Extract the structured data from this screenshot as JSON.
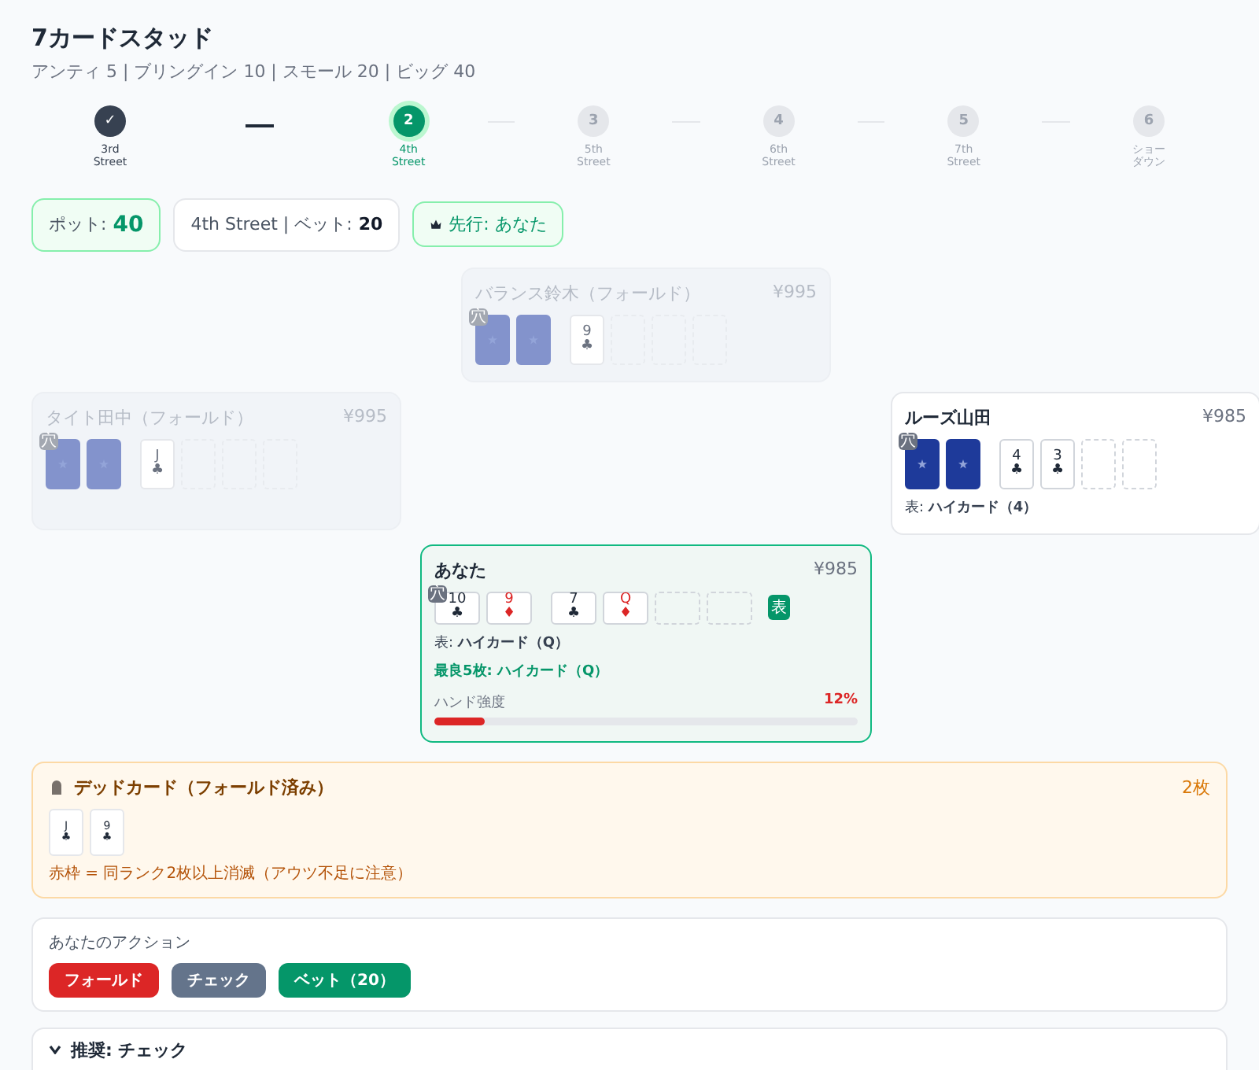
{
  "header": {
    "title": "7カードスタッド",
    "subtitle": "アンティ 5 | ブリングイン 10 | スモール 20 | ビッグ 40"
  },
  "streets": [
    {
      "mark": "✓",
      "lines": [
        "3rd",
        "Street"
      ],
      "completed": true,
      "selected": false
    },
    {
      "mark": "2",
      "lines": [
        "4th",
        "Street"
      ],
      "completed": false,
      "selected": true
    },
    {
      "mark": "3",
      "lines": [
        "5th",
        "Street"
      ],
      "completed": false,
      "selected": false
    },
    {
      "mark": "4",
      "lines": [
        "6th",
        "Street"
      ],
      "completed": false,
      "selected": false
    },
    {
      "mark": "5",
      "lines": [
        "7th",
        "Street"
      ],
      "completed": false,
      "selected": false
    },
    {
      "mark": "6",
      "lines": [
        "ショー",
        "ダウン"
      ],
      "completed": false,
      "selected": false
    }
  ],
  "chips": [
    {
      "kind": "pot",
      "label": "ポット: ",
      "value": "40"
    },
    {
      "kind": "bet",
      "label": "4th Street | ベット: ",
      "value": "20"
    },
    {
      "kind": "first",
      "label": "先行: あなた"
    }
  ],
  "seats": [
    {
      "name": "バランス鈴木（フォールド）",
      "stack": "¥995",
      "folded": true,
      "hero": false,
      "hole_badge": "穴",
      "cards": [
        {
          "kind": "down"
        },
        {
          "kind": "down"
        },
        {
          "kind": "up",
          "rank": "9",
          "suit": "♣",
          "color": "#6b7280"
        },
        {
          "kind": "empty"
        },
        {
          "kind": "empty"
        },
        {
          "kind": "empty"
        }
      ]
    },
    {
      "name": "タイト田中（フォールド）",
      "stack": "¥995",
      "folded": true,
      "hero": false,
      "hole_badge": "穴",
      "cards": [
        {
          "kind": "down"
        },
        {
          "kind": "down"
        },
        {
          "kind": "up",
          "rank": "J",
          "suit": "♣",
          "color": "#6b7280"
        },
        {
          "kind": "empty"
        },
        {
          "kind": "empty"
        },
        {
          "kind": "empty"
        }
      ]
    },
    {
      "name": "ルーズ山田",
      "stack": "¥985",
      "folded": false,
      "hero": false,
      "hole_badge": "穴",
      "cards": [
        {
          "kind": "down"
        },
        {
          "kind": "down"
        },
        {
          "kind": "up",
          "rank": "4",
          "suit": "♣",
          "color": "#1f2937"
        },
        {
          "kind": "up",
          "rank": "3",
          "suit": "♣",
          "color": "#1f2937"
        },
        {
          "kind": "empty"
        },
        {
          "kind": "empty"
        }
      ],
      "showing_label": "表: ",
      "showing": "ハイカード（4）"
    },
    {
      "name": "あなた",
      "stack": "¥985",
      "folded": false,
      "hero": true,
      "hole_badge": "穴",
      "cards": [
        {
          "kind": "up",
          "rank": "10",
          "suit": "♣",
          "color": "#1f2937"
        },
        {
          "kind": "up",
          "rank": "9",
          "suit": "♦",
          "color": "#dc2626"
        },
        {
          "kind": "up",
          "rank": "7",
          "suit": "♣",
          "color": "#1f2937"
        },
        {
          "kind": "up",
          "rank": "Q",
          "suit": "♦",
          "color": "#dc2626"
        },
        {
          "kind": "empty"
        },
        {
          "kind": "empty"
        }
      ],
      "end_badge": "表",
      "showing_label": "表: ",
      "showing": "ハイカード（Q）",
      "best": "最良5枚: ハイカード（Q）",
      "strength": {
        "label": "ハンド強度",
        "value": "12%",
        "level": 0.12
      }
    }
  ],
  "dead_cards": {
    "title": "デッドカード（フォールド済み）",
    "count": "2枚",
    "cards": [
      {
        "rank": "J",
        "suit": "♣",
        "color": "#1f2937"
      },
      {
        "rank": "9",
        "suit": "♣",
        "color": "#1f2937"
      }
    ],
    "note": "赤枠 = 同ランク2枚以上消滅（アウツ不足に注意）"
  },
  "actions": {
    "title": "あなたのアクション",
    "buttons": [
      {
        "label": "フォールド",
        "kind": "fold"
      },
      {
        "label": "チェック",
        "kind": "check"
      },
      {
        "label": "ベット（20）",
        "kind": "bet"
      }
    ]
  },
  "recommendation": {
    "title": "推奨: チェック"
  }
}
